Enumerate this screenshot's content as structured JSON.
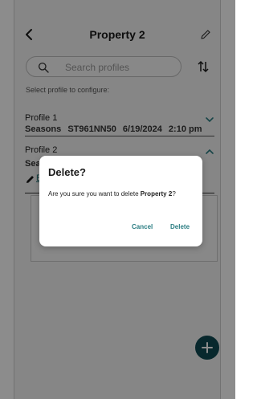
{
  "header": {
    "title": "Property 2"
  },
  "search": {
    "placeholder": "Search profiles",
    "value": ""
  },
  "hint": "Select profile to configure:",
  "profiles": [
    {
      "name": "Profile 1",
      "mode": "Seasons",
      "device": "ST961NN50",
      "date": "6/19/2024",
      "time": "2:10 pm",
      "expanded": false
    },
    {
      "name": "Profile 2",
      "mode_partial": "Sea",
      "edit_partial": "E",
      "expanded": true
    }
  ],
  "dialog": {
    "title": "Delete?",
    "message_prefix": "Are you sure you want to delete ",
    "message_target": "Property 2",
    "message_suffix": "?",
    "cancel_label": "Cancel",
    "delete_label": "Delete"
  },
  "colors": {
    "accent": "#2a7d82",
    "fab": "#0f4a52",
    "scrim": "rgba(0,0,0,0.45)"
  },
  "icons": {
    "back": "chevron-left-icon",
    "edit": "pencil-icon",
    "search": "search-icon",
    "sort": "sort-icon",
    "expand": "chevron-down-icon",
    "collapse": "chevron-up-icon",
    "add": "plus-icon"
  }
}
